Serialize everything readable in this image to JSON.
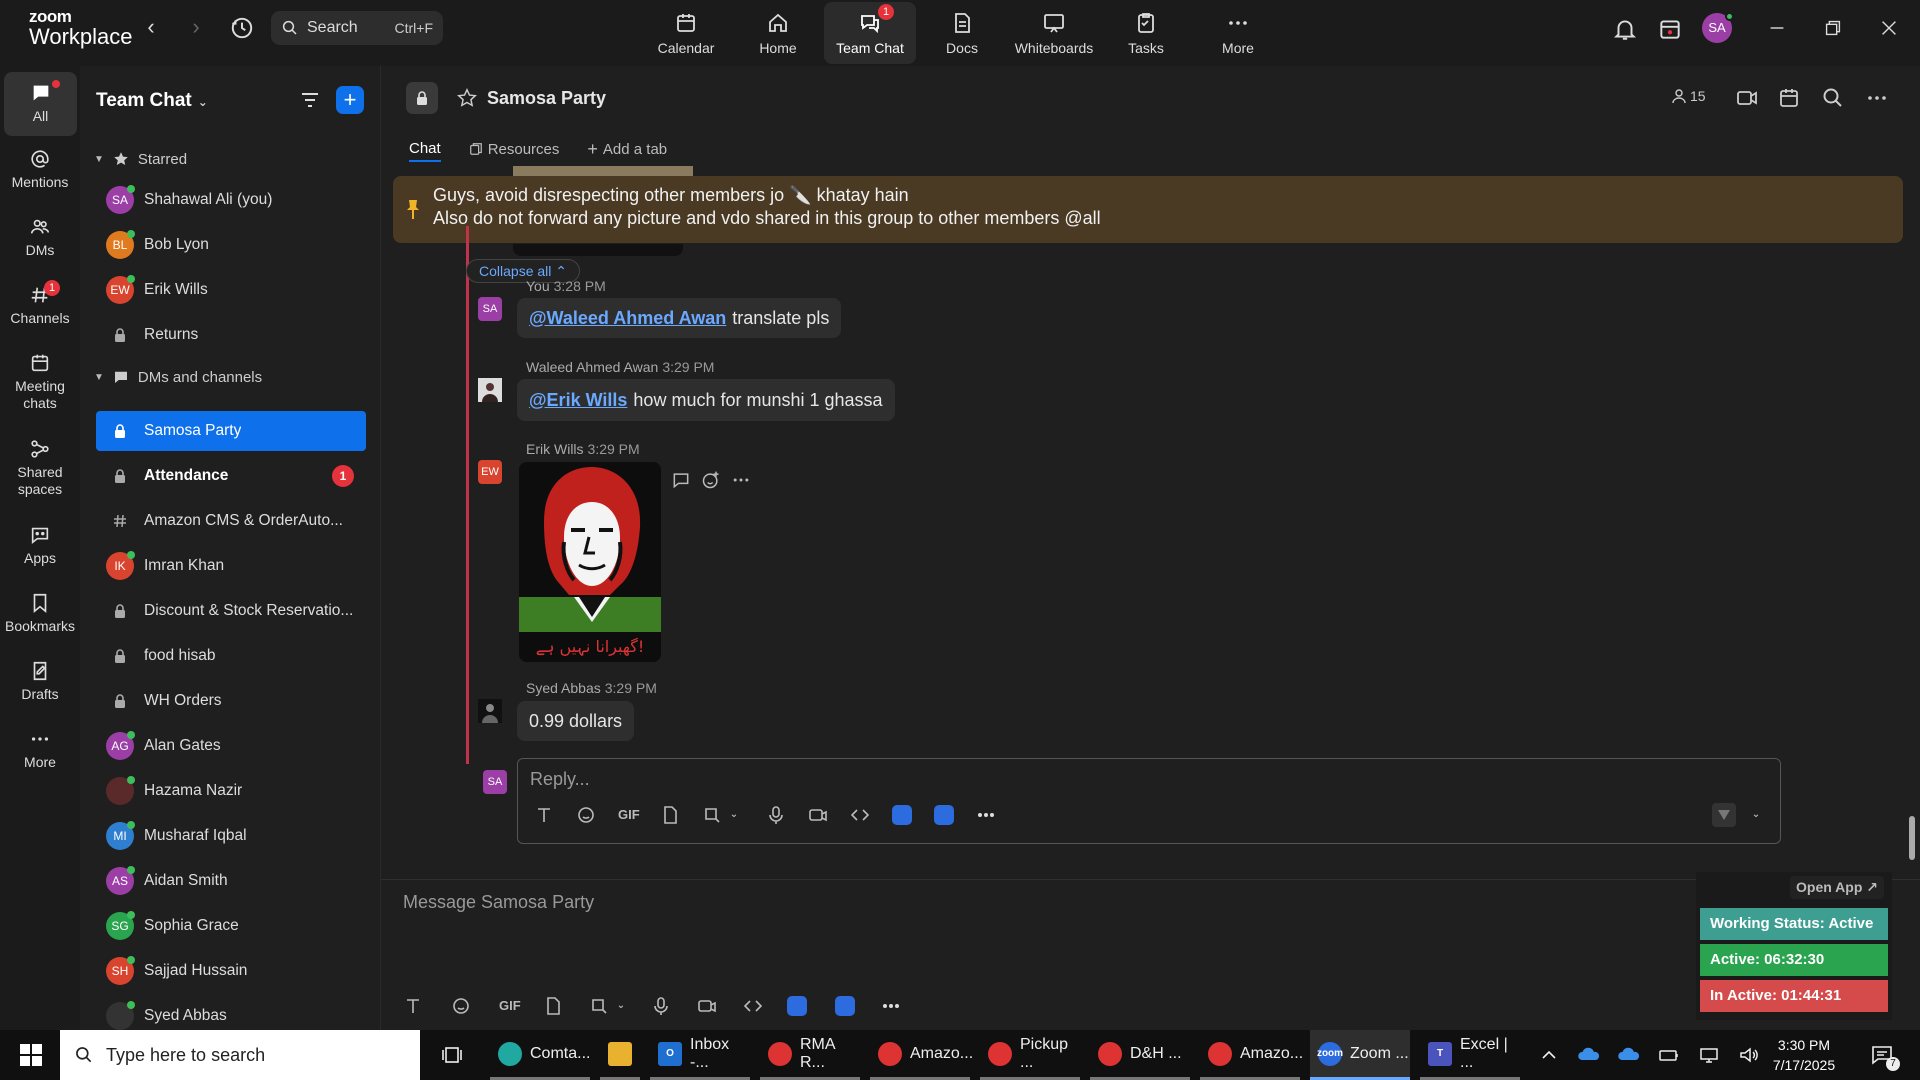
{
  "app": {
    "logo_line1": "zoom",
    "logo_line2": "Workplace"
  },
  "topbar": {
    "search_label": "Search",
    "search_shortcut": "Ctrl+F",
    "tabs": [
      {
        "label": "Calendar",
        "icon": "calendar-icon"
      },
      {
        "label": "Home",
        "icon": "home-icon"
      },
      {
        "label": "Team Chat",
        "icon": "team-chat-icon",
        "badge": "1",
        "active": true
      },
      {
        "label": "Docs",
        "icon": "docs-icon"
      },
      {
        "label": "Whiteboards",
        "icon": "whiteboard-icon"
      },
      {
        "label": "Tasks",
        "icon": "tasks-icon"
      },
      {
        "label": "More",
        "icon": "more-icon"
      }
    ],
    "avatar_initials": "SA"
  },
  "rail": [
    {
      "label": "All",
      "active": true
    },
    {
      "label": "Mentions"
    },
    {
      "label": "DMs"
    },
    {
      "label": "Channels",
      "badge": "1"
    },
    {
      "label": "Meeting chats"
    },
    {
      "label": "Shared spaces"
    },
    {
      "label": "Apps"
    },
    {
      "label": "Bookmarks"
    },
    {
      "label": "Drafts"
    },
    {
      "label": "More"
    }
  ],
  "sidebar": {
    "title": "Team Chat",
    "starred_label": "Starred",
    "dms_label": "DMs and channels",
    "starred": [
      {
        "name": "Shahawal Ali (you)",
        "initials": "SA",
        "color": "#9b3fa6"
      },
      {
        "name": "Bob Lyon",
        "initials": "BL",
        "color": "#e07a1f"
      },
      {
        "name": "Erik Wills",
        "initials": "EW",
        "color": "#d9442f"
      },
      {
        "name": "Returns",
        "type": "lock"
      }
    ],
    "channels": [
      {
        "name": "Samosa Party",
        "type": "lock",
        "active": true
      },
      {
        "name": "Attendance",
        "type": "lock",
        "bold": true,
        "count": "1"
      },
      {
        "name": "Amazon CMS & OrderAuto...",
        "type": "hash"
      },
      {
        "name": "Imran Khan",
        "initials": "IK",
        "color": "#d9442f"
      },
      {
        "name": "Discount & Stock Reservatio...",
        "type": "lock"
      },
      {
        "name": "food hisab",
        "type": "lock"
      },
      {
        "name": "WH Orders",
        "type": "lock"
      },
      {
        "name": "Alan Gates",
        "initials": "AG",
        "color": "#9b3fa6"
      },
      {
        "name": "Hazama Nazir",
        "initials": "",
        "color": "#5a2a2a"
      },
      {
        "name": "Musharaf Iqbal",
        "initials": "MI",
        "color": "#2f7fd1"
      },
      {
        "name": "Aidan Smith",
        "initials": "AS",
        "color": "#9b3fa6"
      },
      {
        "name": "Sophia Grace",
        "initials": "SG",
        "color": "#2aa44f"
      },
      {
        "name": "Sajjad Hussain",
        "initials": "SH",
        "color": "#d9442f"
      },
      {
        "name": "Syed Abbas",
        "initials": "",
        "color": "#333"
      }
    ]
  },
  "channel": {
    "name": "Samosa Party",
    "members": "15",
    "tabs": {
      "chat": "Chat",
      "resources": "Resources",
      "add": "Add a tab"
    },
    "pinned_line1": "Guys, avoid disrespecting other members jo 🔪 khatay hain",
    "pinned_line2": "Also do not forward any picture and vdo shared in this group to other members @all",
    "collapse_label": "Collapse all ⌃"
  },
  "messages": [
    {
      "author": "You",
      "time": "3:28 PM",
      "avatar": "SA",
      "mention": "@Waleed Ahmed Awan",
      "text": "translate pls"
    },
    {
      "author": "Waleed Ahmed Awan",
      "time": "3:29 PM",
      "mention": "@Erik Wills",
      "text": "how much for munshi 1 ghassa"
    },
    {
      "author": "Erik Wills",
      "time": "3:29 PM",
      "avatar": "EW",
      "image_caption": "گھبرانا نہیں ہے!"
    },
    {
      "author": "Syed Abbas",
      "time": "3:29 PM",
      "text": "0.99 dollars"
    }
  ],
  "reply": {
    "placeholder": "Reply...",
    "avatar": "SA",
    "gif": "GIF"
  },
  "compose": {
    "placeholder": "Message Samosa Party",
    "gif": "GIF"
  },
  "status_widget": {
    "open_app": "Open App ↗",
    "working": "Working Status: Active",
    "active": "Active: 06:32:30",
    "inactive": "In Active: 01:44:31",
    "colors": {
      "working": "#3f9e92",
      "active": "#2aa44f",
      "inactive": "#d54a4a"
    }
  },
  "taskbar": {
    "search_placeholder": "Type here to search",
    "apps": [
      {
        "label": "Comta...",
        "color": "#1fa9a0"
      },
      {
        "label": "",
        "color": "#e8b230"
      },
      {
        "label": "Inbox -...",
        "color": "#1f6fd1"
      },
      {
        "label": "RMA R...",
        "color": "#d33"
      },
      {
        "label": "Amazo...",
        "color": "#d33"
      },
      {
        "label": "Pickup ...",
        "color": "#d33"
      },
      {
        "label": "D&H ...",
        "color": "#d33"
      },
      {
        "label": "Amazo...",
        "color": "#d33"
      },
      {
        "label": "Zoom ...",
        "color": "#2d6cdf",
        "active": true
      },
      {
        "label": "Excel | ...",
        "color": "#4b53bc"
      }
    ],
    "time": "3:30 PM",
    "date": "7/17/2025",
    "notification_count": "7"
  }
}
